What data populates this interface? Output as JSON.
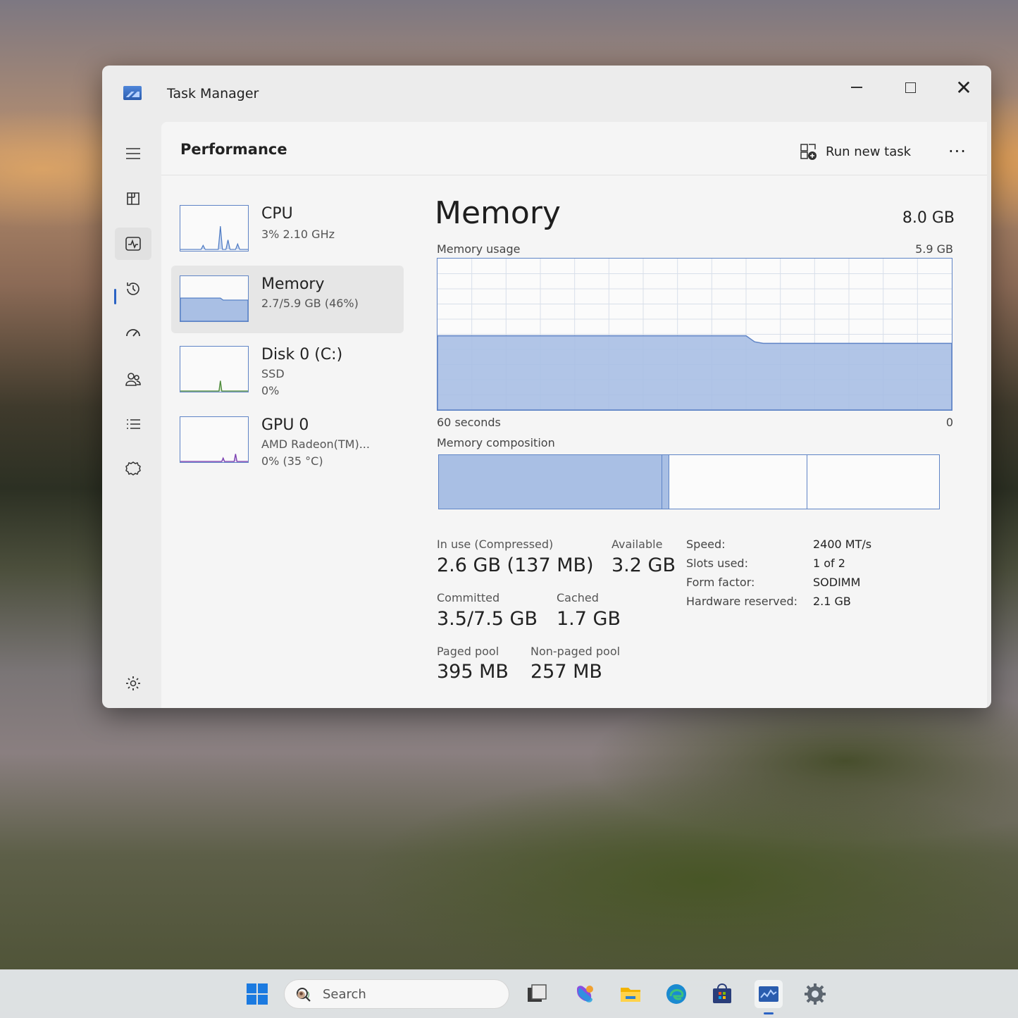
{
  "window": {
    "title": "Task Manager",
    "close_glyph": "✕"
  },
  "nav": {
    "items": [
      {
        "icon": "hamburger-icon"
      },
      {
        "icon": "processes-icon"
      },
      {
        "icon": "performance-icon",
        "active": true
      },
      {
        "icon": "app-history-icon"
      },
      {
        "icon": "startup-apps-icon"
      },
      {
        "icon": "users-icon"
      },
      {
        "icon": "details-icon"
      },
      {
        "icon": "services-icon"
      },
      {
        "icon": "settings-icon"
      }
    ]
  },
  "header": {
    "title": "Performance",
    "run_new_task": "Run new task",
    "more": "···"
  },
  "devices": [
    {
      "name": "CPU",
      "line1": "3%  2.10 GHz"
    },
    {
      "name": "Memory",
      "line1": "2.7/5.9 GB (46%)",
      "selected": true
    },
    {
      "name": "Disk 0 (C:)",
      "line1": "SSD",
      "line2": "0%"
    },
    {
      "name": "GPU 0",
      "line1": "AMD Radeon(TM)...",
      "line2": "0% (35 °C)"
    }
  ],
  "memory": {
    "title": "Memory",
    "total": "8.0 GB",
    "usage_label": "Memory usage",
    "usage_max": "5.9 GB",
    "axis_left": "60 seconds",
    "axis_right": "0",
    "composition_label": "Memory composition",
    "composition_fractions": [
      0.447,
      0.013,
      0.277,
      0.263
    ],
    "usage_series": [
      0.49,
      0.49,
      0.49,
      0.49,
      0.49,
      0.49,
      0.49,
      0.49,
      0.49,
      0.49,
      0.49,
      0.49,
      0.49,
      0.49,
      0.49,
      0.49,
      0.49,
      0.49,
      0.49,
      0.49,
      0.49,
      0.49,
      0.49,
      0.49,
      0.49,
      0.49,
      0.49,
      0.49,
      0.49,
      0.49,
      0.49,
      0.49,
      0.49,
      0.49,
      0.49,
      0.49,
      0.49,
      0.45,
      0.44,
      0.44,
      0.44,
      0.44,
      0.44,
      0.44,
      0.44,
      0.44,
      0.44,
      0.44,
      0.44,
      0.44,
      0.44,
      0.44,
      0.44,
      0.44,
      0.44,
      0.44,
      0.44,
      0.44,
      0.44,
      0.44,
      0.44
    ],
    "stats": {
      "in_use_label": "In use (Compressed)",
      "in_use_value": "2.6 GB (137 MB)",
      "available_label": "Available",
      "available_value": "3.2 GB",
      "committed_label": "Committed",
      "committed_value": "3.5/7.5 GB",
      "cached_label": "Cached",
      "cached_value": "1.7 GB",
      "paged_label": "Paged pool",
      "paged_value": "395 MB",
      "nonpaged_label": "Non-paged pool",
      "nonpaged_value": "257 MB"
    },
    "specs": [
      {
        "key": "Speed:",
        "value": "2400 MT/s"
      },
      {
        "key": "Slots used:",
        "value": "1 of 2"
      },
      {
        "key": "Form factor:",
        "value": "SODIMM"
      },
      {
        "key": "Hardware reserved:",
        "value": "2.1 GB"
      }
    ]
  },
  "taskbar": {
    "search_placeholder": "Search"
  },
  "colors": {
    "accent": "#2b63c4",
    "graph_fill": "#a9bfe4",
    "graph_line": "#5f84c6"
  }
}
